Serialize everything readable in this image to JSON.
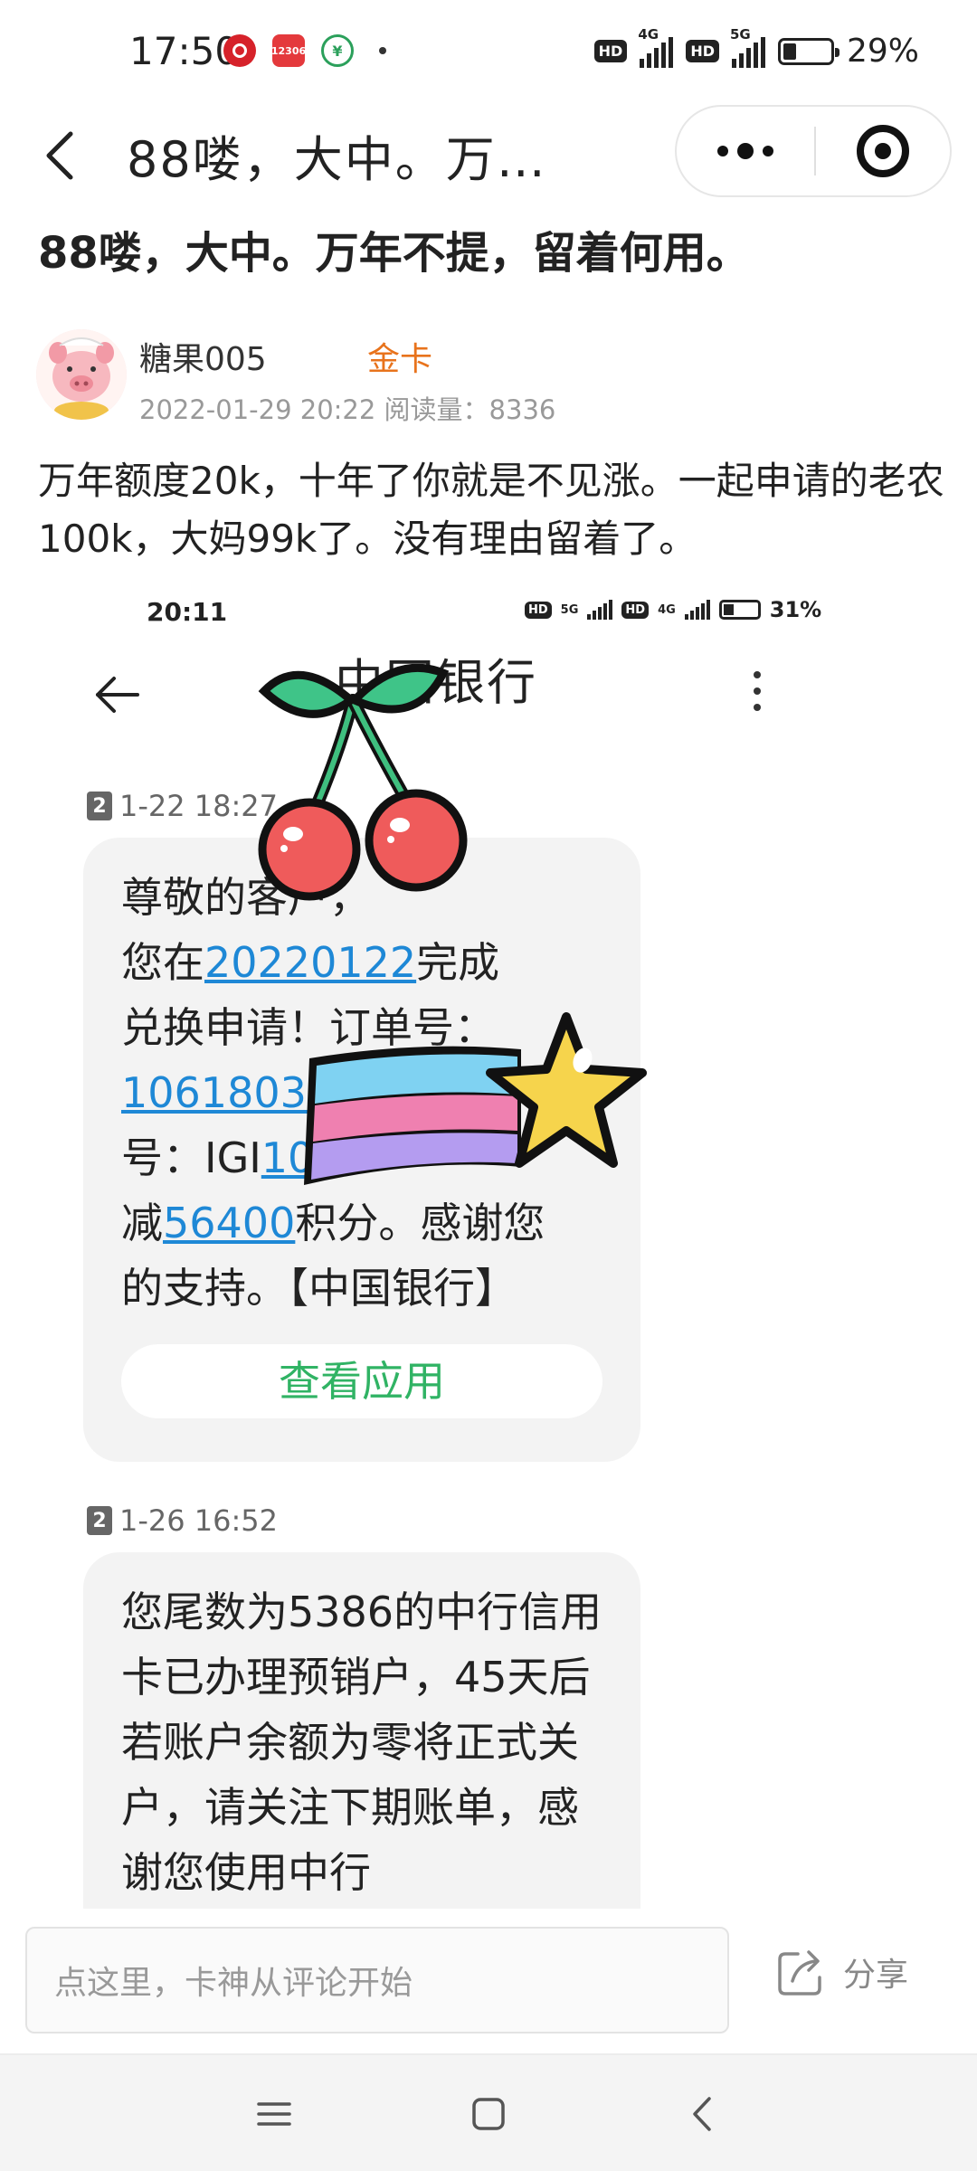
{
  "status_bar": {
    "time": "17:50",
    "battery_percent": "29%",
    "battery_level": 0.29,
    "network_1": "4G",
    "network_2": "5G",
    "hd_label": "HD"
  },
  "nav": {
    "title": "88喽，大中。万…",
    "more_icon": "more-dots-icon",
    "close_icon": "target-close-icon"
  },
  "post": {
    "title": "88喽，大中。万年不提，留着何用。",
    "author": {
      "name": "糖果005",
      "badge": "金卡",
      "meta": "2022-01-29 20:22  阅读量：8336"
    },
    "body": "万年额度20k，十年了你就是不见涨。一起申请的老农100k，大妈99k了。没有理由留着了。"
  },
  "screenshot": {
    "status_time": "20:11",
    "status_battery": "31%",
    "status_net_1": "5G",
    "status_net_2": "4G",
    "title": "中国银行",
    "messages": [
      {
        "sim": "2",
        "time": "1-22 18:27",
        "segments": [
          {
            "text": "尊敬的",
            "link": false
          },
          {
            "text": "客户，",
            "link": false
          },
          {
            "text": "\n您在",
            "link": false
          },
          {
            "text": "20220122",
            "link": true
          },
          {
            "text": "完成\n兑换申请！订单号：\n",
            "link": false
          },
          {
            "text": "10618031",
            "link": true
          },
          {
            "text": "\n号：IGI",
            "link": false
          },
          {
            "text": "10",
            "link": true
          },
          {
            "text": "\n减",
            "link": false
          },
          {
            "text": "56400",
            "link": true
          },
          {
            "text": "积分。感谢您\n的支持。【中国银行】",
            "link": false
          }
        ],
        "button": "查看应用"
      },
      {
        "sim": "2",
        "time": "1-26 16:52",
        "text": "您尾数为5386的中行信用卡已办理预销户，45天后若账户余额为零将正式关户，请关注下期账单，感谢您使用中行"
      }
    ]
  },
  "comment_bar": {
    "placeholder": "点这里，卡神从评论开始",
    "share_label": "分享"
  },
  "system_nav": {
    "menu_icon": "menu-icon",
    "home_icon": "home-icon",
    "back_icon": "back-icon"
  }
}
